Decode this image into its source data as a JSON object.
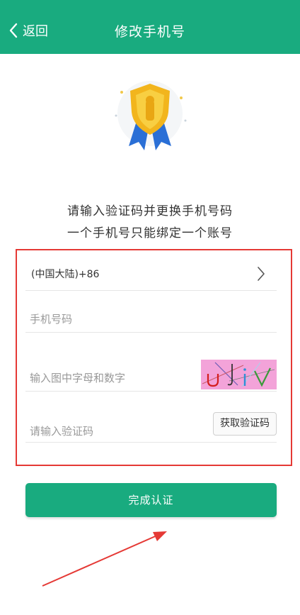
{
  "header": {
    "back_label": "返回",
    "title": "修改手机号"
  },
  "icons": {
    "back": "chevron-left-icon",
    "medal": "medal-badge-icon",
    "chevron": "chevron-right-icon",
    "arrow": "red-arrow"
  },
  "message": {
    "line1": "请输入验证码并更换手机号码",
    "line2": "一个手机号只能绑定一个账号"
  },
  "form": {
    "country_code": "(中国大陆)+86",
    "phone_placeholder": "手机号码",
    "captcha_placeholder": "输入图中字母和数字",
    "captcha_text": "UJiV",
    "code_placeholder": "请输入验证码",
    "get_code_label": "获取验证码"
  },
  "submit": {
    "label": "完成认证"
  },
  "colors": {
    "brand": "#19ab7f",
    "highlight_border": "#e53935",
    "captcha_bg": "#f3a3d9"
  }
}
